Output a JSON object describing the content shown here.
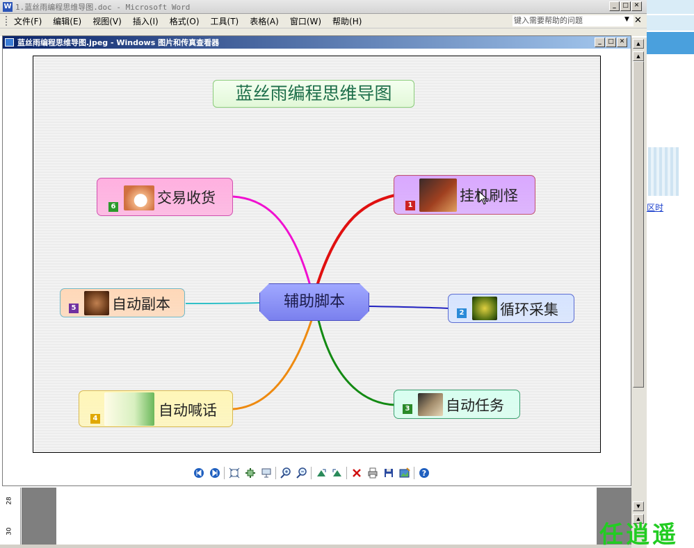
{
  "word": {
    "title": "1.蓝丝雨编程思维导图.doc - Microsoft Word",
    "menu": [
      "文件(F)",
      "编辑(E)",
      "视图(V)",
      "插入(I)",
      "格式(O)",
      "工具(T)",
      "表格(A)",
      "窗口(W)",
      "帮助(H)"
    ],
    "help_placeholder": "键入需要帮助的问题",
    "ruler_ticks": [
      "28",
      "30"
    ]
  },
  "side_strip": {
    "link_text": "区时"
  },
  "viewer": {
    "title": "蓝丝雨编程思维导图.jpeg - Windows 图片和传真查看器",
    "toolbar_icons": [
      "prev-image-icon",
      "next-image-icon",
      "best-fit-icon",
      "actual-size-icon",
      "slideshow-icon",
      "zoom-in-icon",
      "zoom-out-icon",
      "rotate-clockwise-icon",
      "rotate-counterclockwise-icon",
      "delete-icon",
      "print-icon",
      "save-icon",
      "open-in-editor-icon",
      "help-icon"
    ]
  },
  "mindmap": {
    "title": "蓝丝雨编程思维导图",
    "center": "辅助脚本",
    "nodes": [
      {
        "id": "1",
        "label": "挂机刷怪",
        "color": "#d9a8ff",
        "border": "#c05070",
        "badge_color": "#cc2222",
        "line_color": "#e01010",
        "icon": "crossed-swords-icon"
      },
      {
        "id": "2",
        "label": "循环采集",
        "color": "#d6e4ff",
        "border": "#5a6ad0",
        "badge_color": "#2a8ad8",
        "line_color": "#2020c0",
        "icon": "herb-gathering-icon"
      },
      {
        "id": "3",
        "label": "自动任务",
        "color": "#d8fff0",
        "border": "#3aa070",
        "badge_color": "#2a8a2a",
        "line_color": "#138a13",
        "icon": "quest-scroll-icon"
      },
      {
        "id": "4",
        "label": "自动喊话",
        "color": "#fff6b8",
        "border": "#d8b850",
        "badge_color": "#e0a800",
        "line_color": "#ee8a10",
        "icon": "megaphone-icon"
      },
      {
        "id": "5",
        "label": "自动副本",
        "color": "#ffd8b8",
        "border": "#70b8c8",
        "badge_color": "#7030a0",
        "line_color": "#30c0c8",
        "icon": "orc-face-icon"
      },
      {
        "id": "6",
        "label": "交易收货",
        "color": "#ffb0e0",
        "border": "#d050b0",
        "badge_color": "#2a9a2a",
        "line_color": "#f010d0",
        "icon": "money-bag-icon"
      }
    ]
  },
  "watermark": "任逍遥"
}
